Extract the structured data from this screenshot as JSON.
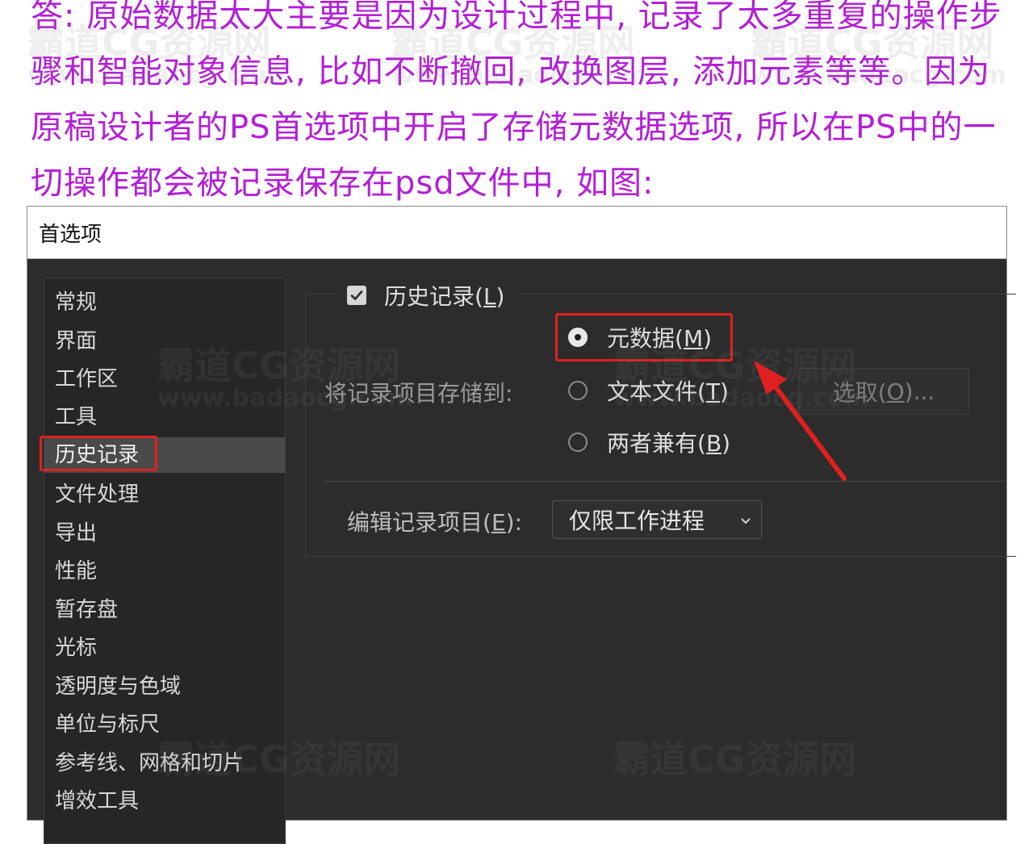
{
  "caption": "答: 原始数据太大主要是因为设计过程中, 记录了太多重复的操作步骤和智能对象信息, 比如不断撤回, 改换图层, 添加元素等等。因为原稿设计者的PS首选项中开启了存储元数据选项, 所以在PS中的一切操作都会被记录保存在psd文件中, 如图:",
  "watermark": {
    "name": "霸道CG资源网",
    "url": "www.badaocg.com"
  },
  "dialog": {
    "title": "首选项",
    "sidebar": {
      "items": [
        {
          "label": "常规"
        },
        {
          "label": "界面"
        },
        {
          "label": "工作区"
        },
        {
          "label": "工具"
        },
        {
          "label": "历史记录",
          "selected": true
        },
        {
          "label": "文件处理"
        },
        {
          "label": "导出"
        },
        {
          "label": "性能"
        },
        {
          "label": "暂存盘"
        },
        {
          "label": "光标"
        },
        {
          "label": "透明度与色域"
        },
        {
          "label": "单位与标尺"
        },
        {
          "label": "参考线、网格和切片"
        },
        {
          "label": "增效工具"
        }
      ]
    },
    "history": {
      "checkbox_label": "历史记录(",
      "checkbox_key": "L",
      "checkbox_suffix": ")",
      "checked": true,
      "store_label": "将记录项目存储到:",
      "options": [
        {
          "label": "元数据(",
          "key": "M",
          "suffix": ")",
          "selected": true
        },
        {
          "label": "文本文件(",
          "key": "T",
          "suffix": ")",
          "selected": false
        },
        {
          "label": "两者兼有(",
          "key": "B",
          "suffix": ")",
          "selected": false
        }
      ],
      "choose_label": "选取(",
      "choose_key": "O",
      "choose_suffix": ")...",
      "edit_label": "编辑记录项目(",
      "edit_key": "E",
      "edit_suffix": "):",
      "edit_value": "仅限工作进程"
    }
  },
  "colors": {
    "caption": "#b31fd6",
    "highlight": "#e02020"
  }
}
